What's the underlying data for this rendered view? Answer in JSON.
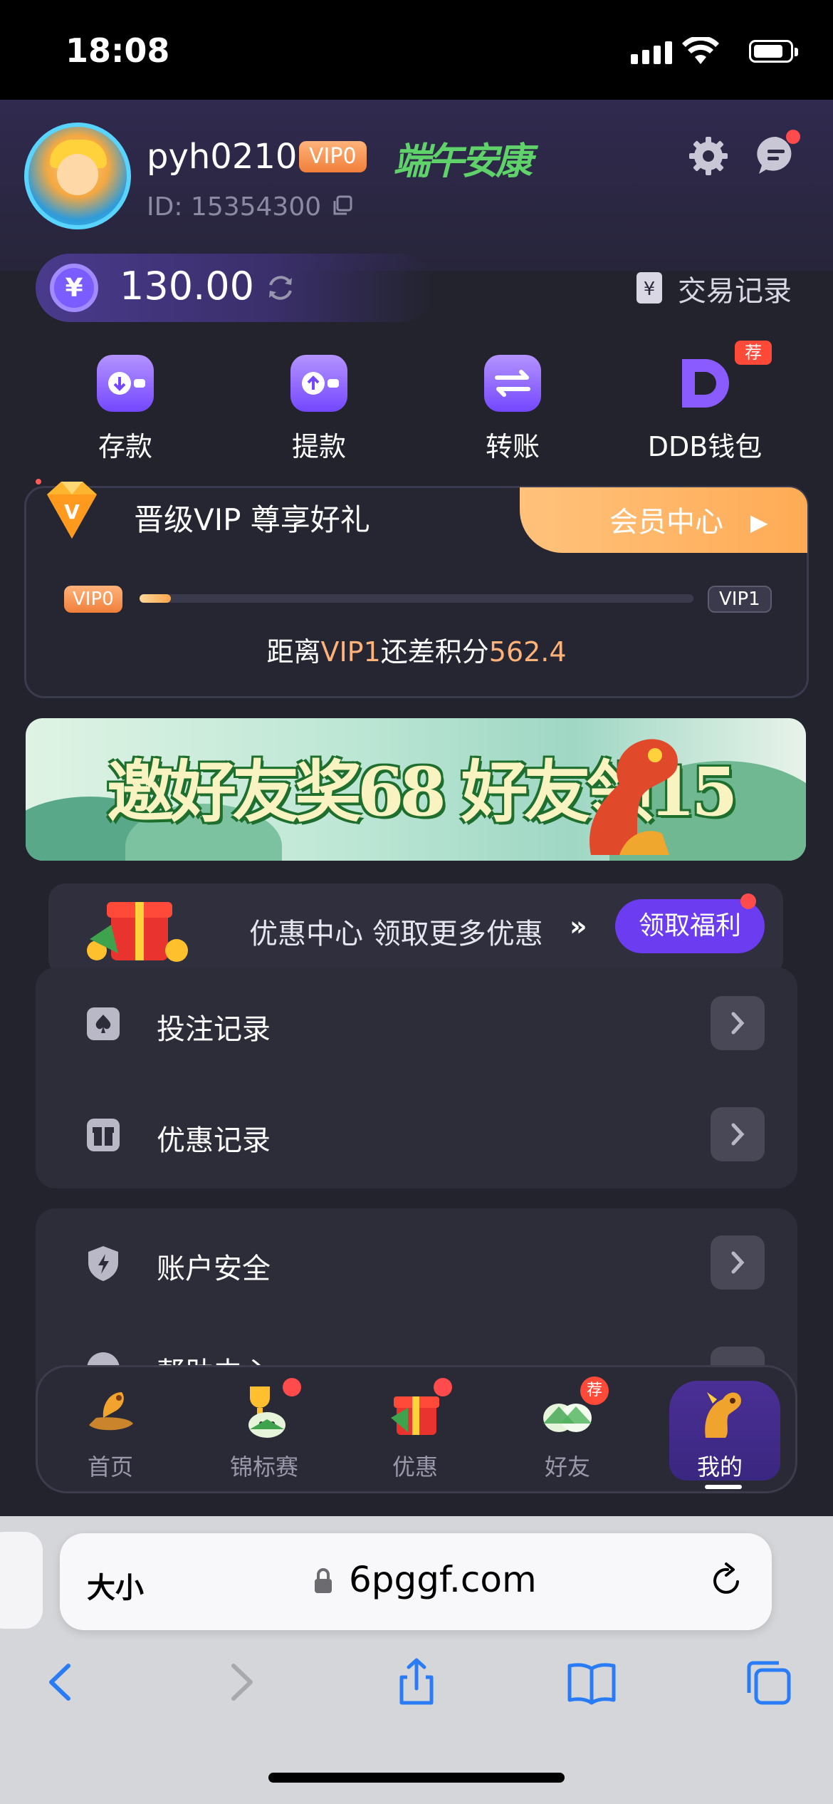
{
  "status_bar": {
    "time": "18:08"
  },
  "profile": {
    "username": "pyh0210",
    "vip_badge": "VIP0",
    "festival_text": "端午安康",
    "user_id": "ID: 15354300"
  },
  "wallet": {
    "currency_symbol": "¥",
    "balance": "130.00",
    "transactions_label": "交易记录"
  },
  "quick_actions": [
    {
      "label": "存款",
      "icon": "deposit-wallet-icon"
    },
    {
      "label": "提款",
      "icon": "withdraw-wallet-icon"
    },
    {
      "label": "转账",
      "icon": "transfer-icon"
    },
    {
      "label": "DDB钱包",
      "icon": "ddb-wallet-icon",
      "badge": "荐"
    }
  ],
  "vip": {
    "title": "晋级VIP 尊享好礼",
    "member_center": "会员中心",
    "current_level": "VIP0",
    "next_level": "VIP1",
    "progress_fraction": 0.04,
    "remain_prefix": "距离",
    "remain_level": "VIP1",
    "remain_middle": "还差积分",
    "remain_points": "562.4"
  },
  "banner": {
    "text": "邀好友奖68 好友领15"
  },
  "promo": {
    "text": "优惠中心 领取更多优惠",
    "arrows": "»",
    "button": "领取福利"
  },
  "menu_group_1": [
    {
      "label": "投注记录",
      "icon": "bet-record-icon"
    },
    {
      "label": "优惠记录",
      "icon": "gift-record-icon"
    }
  ],
  "menu_group_2": [
    {
      "label": "账户安全",
      "icon": "shield-icon"
    },
    {
      "label": "帮助中心",
      "icon": "help-icon"
    }
  ],
  "tabbar": [
    {
      "label": "首页",
      "icon": "home-dragon-icon"
    },
    {
      "label": "锦标赛",
      "icon": "trophy-icon"
    },
    {
      "label": "优惠",
      "icon": "gift-box-icon"
    },
    {
      "label": "好友",
      "icon": "friends-icon",
      "badge": "荐"
    },
    {
      "label": "我的",
      "icon": "dragon-profile-icon",
      "active": true
    }
  ],
  "browser": {
    "text_size": "大小",
    "url": "6pggf.com"
  },
  "colors": {
    "accent_purple": "#6c3cf0",
    "vip_orange": "#ffab55",
    "highlight": "#ffb27a",
    "background": "#22232d"
  }
}
